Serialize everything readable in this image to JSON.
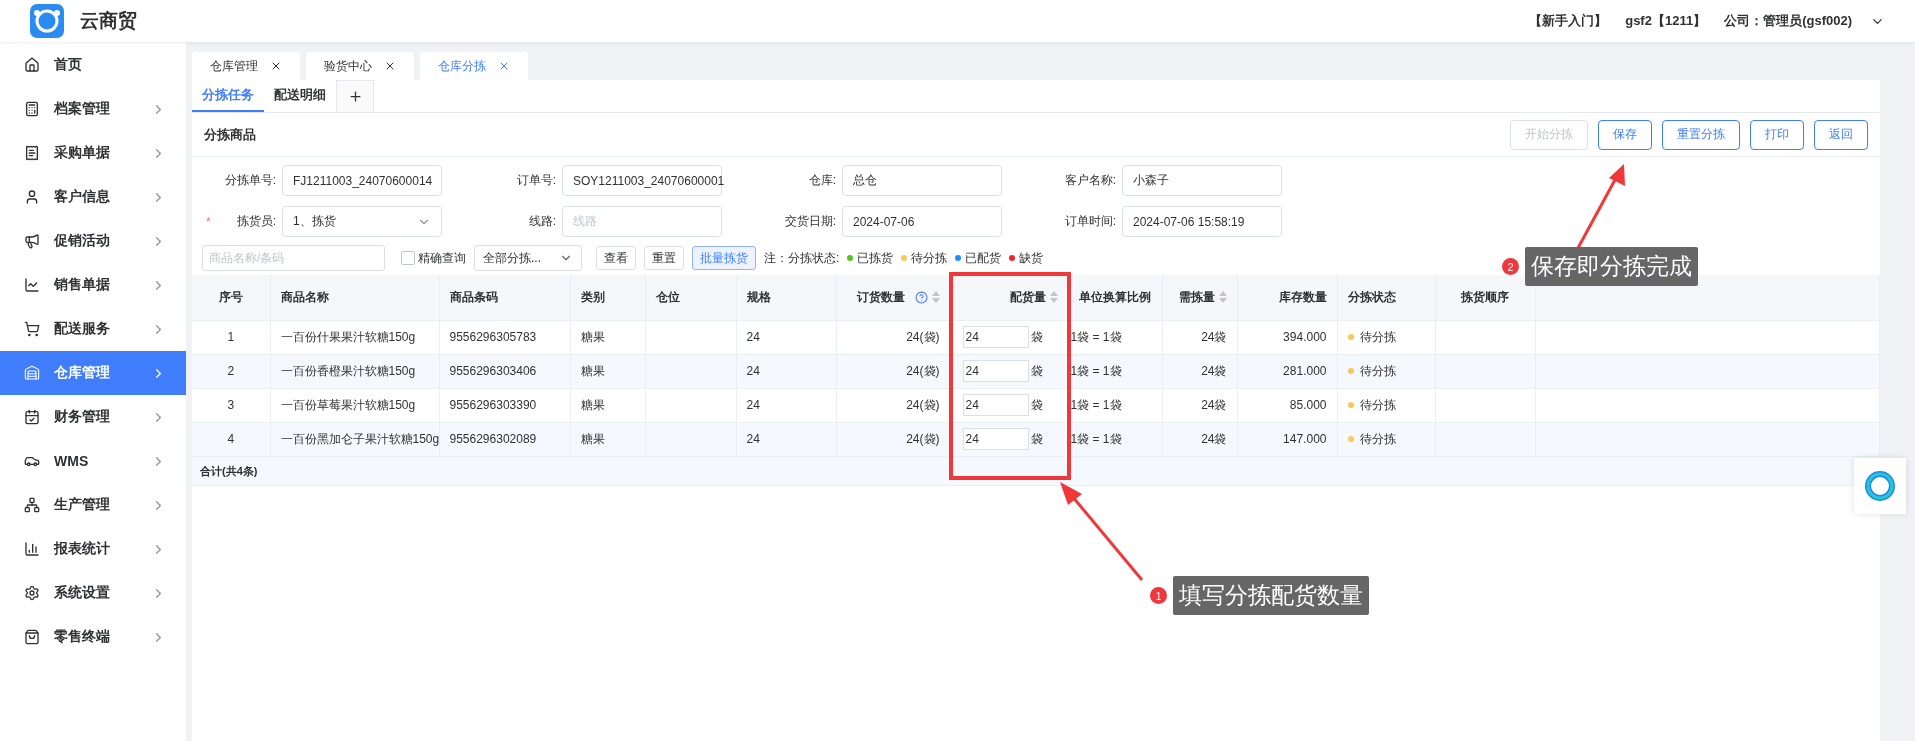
{
  "header": {
    "app_name": "云商贸",
    "links": [
      "【新手入门】",
      "gsf2【1211】",
      "公司：管理员(gsf002)"
    ]
  },
  "sidebar": {
    "items": [
      {
        "label": "首页",
        "selected": false,
        "kind": "link"
      },
      {
        "label": "档案管理",
        "selected": false,
        "kind": "menu"
      },
      {
        "label": "采购单据",
        "selected": false,
        "kind": "menu"
      },
      {
        "label": "客户信息",
        "selected": false,
        "kind": "menu"
      },
      {
        "label": "促销活动",
        "selected": false,
        "kind": "menu"
      },
      {
        "label": "销售单据",
        "selected": false,
        "kind": "menu"
      },
      {
        "label": "配送服务",
        "selected": false,
        "kind": "menu"
      },
      {
        "label": "仓库管理",
        "selected": true,
        "kind": "menu"
      },
      {
        "label": "财务管理",
        "selected": false,
        "kind": "menu"
      },
      {
        "label": "WMS",
        "selected": false,
        "kind": "menu"
      },
      {
        "label": "生产管理",
        "selected": false,
        "kind": "menu"
      },
      {
        "label": "报表统计",
        "selected": false,
        "kind": "menu"
      },
      {
        "label": "系统设置",
        "selected": false,
        "kind": "menu"
      },
      {
        "label": "零售终端",
        "selected": false,
        "kind": "menu"
      }
    ]
  },
  "tabs": [
    {
      "label": "仓库管理",
      "selected": false
    },
    {
      "label": "验货中心",
      "selected": false
    },
    {
      "label": "仓库分拣",
      "selected": true
    }
  ],
  "subtabs": [
    {
      "label": "分拣任务",
      "selected": true
    },
    {
      "label": "配送明细",
      "selected": false
    }
  ],
  "card": {
    "title": "分拣商品",
    "buttons": [
      {
        "label": "开始分拣",
        "disabled": true
      },
      {
        "label": "保存",
        "disabled": false
      },
      {
        "label": "重置分拣",
        "disabled": false
      },
      {
        "label": "打印",
        "disabled": false
      },
      {
        "label": "返回",
        "disabled": false
      }
    ],
    "fields": [
      {
        "label": "分拣单号:",
        "value": "FJ1211003_24070600014",
        "kind": "text"
      },
      {
        "label": "订单号:",
        "value": "SOY1211003_24070600001",
        "kind": "text"
      },
      {
        "label": "仓库:",
        "value": "总仓",
        "kind": "text"
      },
      {
        "label": "客户名称:",
        "value": "小森子",
        "kind": "text"
      },
      {
        "required_mark": "*",
        "label": "拣货员:",
        "value": "1、拣货",
        "kind": "select"
      },
      {
        "label": "线路:",
        "placeholder": "线路",
        "kind": "text"
      },
      {
        "label": "交货日期:",
        "value": "2024-07-06",
        "kind": "text"
      },
      {
        "label": "订单时间:",
        "value": "2024-07-06 15:58:19",
        "kind": "text"
      }
    ],
    "filter": {
      "search_placeholder": "商品名称/条码",
      "exact": {
        "label": "精确查询",
        "checked": false
      },
      "status_select": "全部分拣...",
      "buttons": [
        {
          "label": "查看",
          "kind": "plain"
        },
        {
          "label": "重置",
          "kind": "plain"
        },
        {
          "label": "批量拣货",
          "kind": "primary"
        }
      ],
      "legend_title": "注：分拣状态:",
      "legend": [
        {
          "label": "已拣货",
          "color": "#52c41a"
        },
        {
          "label": "待分拣",
          "color": "#fac858"
        },
        {
          "label": "已配货",
          "color": "#1890ff"
        },
        {
          "label": "缺货",
          "color": "#f5222d"
        }
      ]
    },
    "table": {
      "columns": [
        {
          "label": "序号",
          "sortable": false,
          "help": false
        },
        {
          "label": "商品名称",
          "sortable": false,
          "help": false
        },
        {
          "label": "商品条码",
          "sortable": false,
          "help": false
        },
        {
          "label": "类别",
          "sortable": false,
          "help": false
        },
        {
          "label": "仓位",
          "sortable": false,
          "help": false
        },
        {
          "label": "规格",
          "sortable": false,
          "help": false
        },
        {
          "label": "订货数量",
          "sortable": true,
          "help": true
        },
        {
          "label": "配货量",
          "sortable": true,
          "help": false
        },
        {
          "label": "单位换算比例",
          "sortable": false,
          "help": false
        },
        {
          "label": "需拣量",
          "sortable": true,
          "help": false
        },
        {
          "label": "库存数量",
          "sortable": false,
          "help": false
        },
        {
          "label": "分拣状态",
          "sortable": false,
          "help": false
        },
        {
          "label": "拣货顺序",
          "sortable": false,
          "help": false
        }
      ],
      "rows": [
        {
          "no": "1",
          "name": "一百份什果果汁软糖150g",
          "barcode": "9556296305783",
          "category": "糖果",
          "spec": "24",
          "ordered": "24(袋)",
          "allocated": "24",
          "unit": "袋",
          "ratio": "1袋 = 1袋",
          "need": "24袋",
          "stock": "394.000",
          "status": {
            "label": "待分拣",
            "color": "#fac858"
          }
        },
        {
          "no": "2",
          "name": "一百份香橙果汁软糖150g",
          "barcode": "9556296303406",
          "category": "糖果",
          "spec": "24",
          "ordered": "24(袋)",
          "allocated": "24",
          "unit": "袋",
          "ratio": "1袋 = 1袋",
          "need": "24袋",
          "stock": "281.000",
          "status": {
            "label": "待分拣",
            "color": "#fac858"
          }
        },
        {
          "no": "3",
          "name": "一百份草莓果汁软糖150g",
          "barcode": "9556296303390",
          "category": "糖果",
          "spec": "24",
          "ordered": "24(袋)",
          "allocated": "24",
          "unit": "袋",
          "ratio": "1袋 = 1袋",
          "need": "24袋",
          "stock": "85.000",
          "status": {
            "label": "待分拣",
            "color": "#fac858"
          }
        },
        {
          "no": "4",
          "name": "一百份黑加仑子果汁软糖150g",
          "barcode": "9556296302089",
          "category": "糖果",
          "spec": "24",
          "ordered": "24(袋)",
          "allocated": "24",
          "unit": "袋",
          "ratio": "1袋 = 1袋",
          "need": "24袋",
          "stock": "147.000",
          "status": {
            "label": "待分拣",
            "color": "#fac858"
          }
        }
      ],
      "summary": "合计(共4条)"
    }
  },
  "annotations": [
    {
      "number": "1",
      "text": "填写分拣配货数量"
    },
    {
      "number": "2",
      "text": "保存即分拣完成"
    }
  ]
}
